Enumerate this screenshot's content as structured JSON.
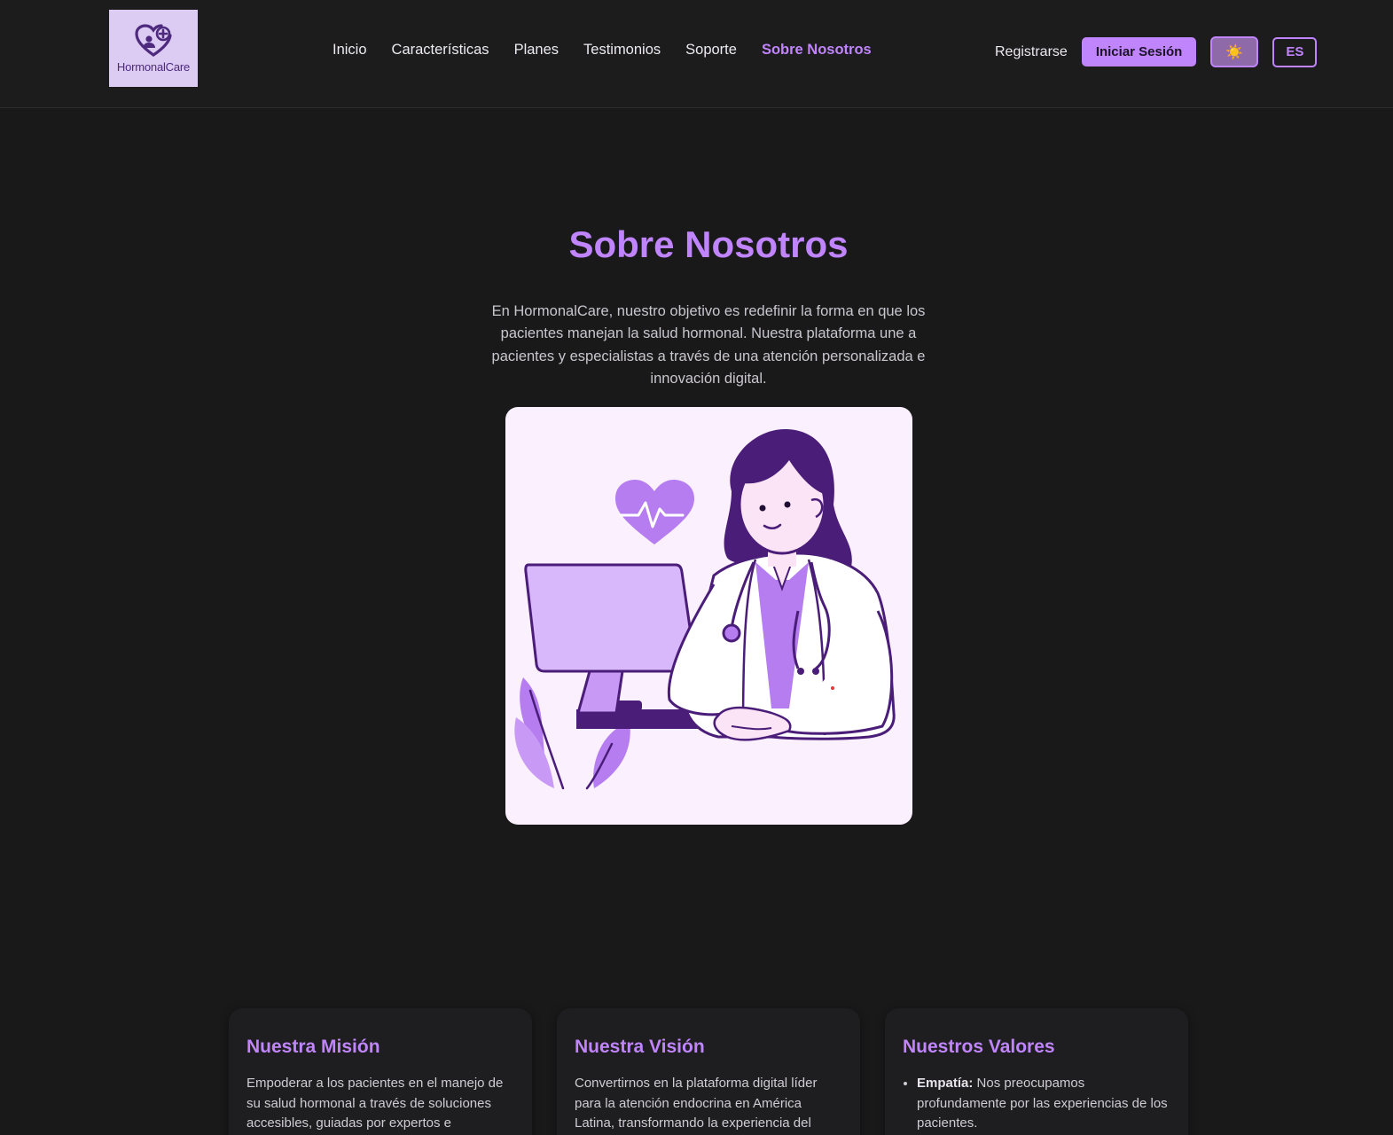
{
  "brand": {
    "name": "HormonalCare"
  },
  "nav": {
    "items": [
      {
        "label": "Inicio"
      },
      {
        "label": "Características"
      },
      {
        "label": "Planes"
      },
      {
        "label": "Testimonios"
      },
      {
        "label": "Soporte"
      },
      {
        "label": "Sobre Nosotros"
      }
    ],
    "active": "Sobre Nosotros"
  },
  "actions": {
    "register_label": "Registrarse",
    "login_label": "Iniciar Sesión",
    "theme_icon": "☀️",
    "language_label": "ES"
  },
  "about": {
    "title": "Sobre Nosotros",
    "intro": "En HormonalCare, nuestro objetivo es redefinir la forma en que los pacientes manejan la salud hormonal. Nuestra plataforma une a pacientes y especialistas a través de una atención personalizada e innovación digital."
  },
  "cards": {
    "mission": {
      "title": "Nuestra Misión",
      "text": "Empoderar a los pacientes en el manejo de su salud hormonal a través de soluciones accesibles, guiadas por expertos e"
    },
    "vision": {
      "title": "Nuestra Visión",
      "text": "Convertirnos en la plataforma digital líder para la atención endocrina en América Latina, transformando la experiencia del"
    },
    "values": {
      "title": "Nuestros Valores",
      "items": [
        {
          "term": "Empatía:",
          "text": " Nos preocupamos profundamente por las experiencias de los pacientes."
        }
      ]
    }
  },
  "colors": {
    "accent": "#c084fc",
    "background": "#19191a",
    "logo_bg": "#dccbf3"
  }
}
